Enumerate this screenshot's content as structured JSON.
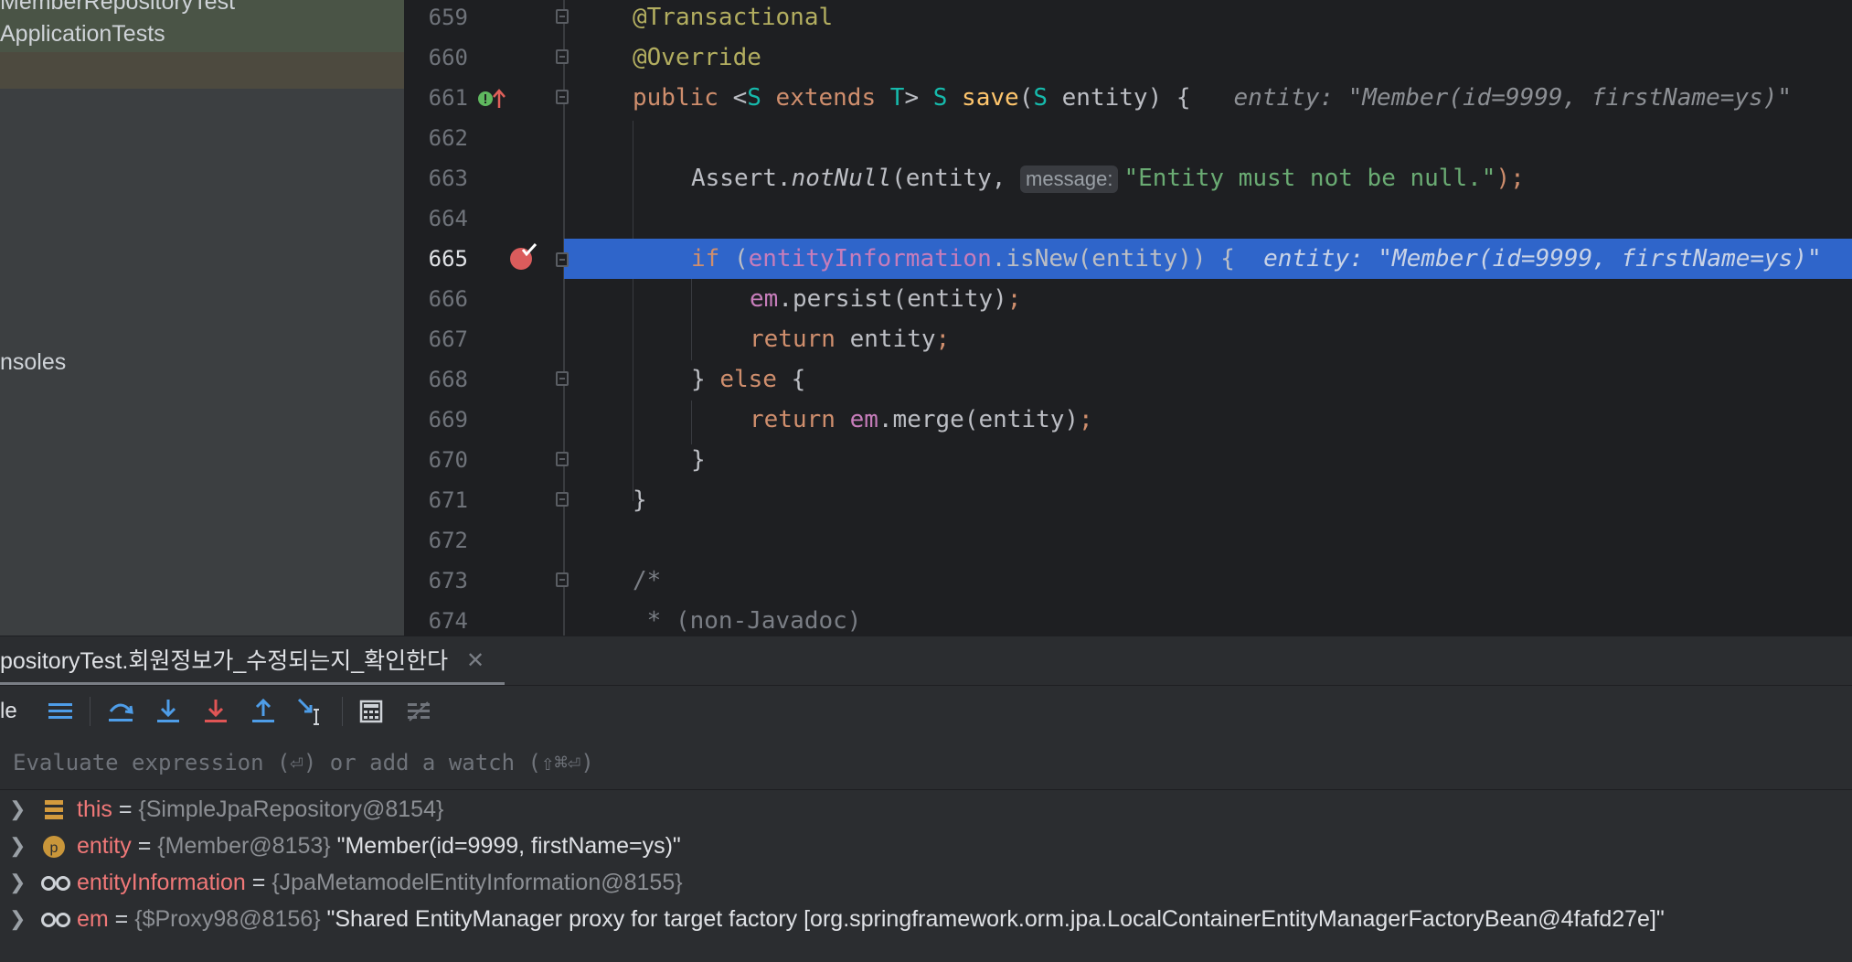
{
  "sidebar": {
    "items": [
      {
        "label": "MemberRepositoryTest"
      },
      {
        "label": "ApplicationTests"
      },
      {
        "label": ""
      },
      {
        "label": "nsoles"
      }
    ]
  },
  "editor": {
    "lines": [
      {
        "num": "659"
      },
      {
        "num": "660"
      },
      {
        "num": "661"
      },
      {
        "num": "662"
      },
      {
        "num": "663"
      },
      {
        "num": "664"
      },
      {
        "num": "665"
      },
      {
        "num": "666"
      },
      {
        "num": "667"
      },
      {
        "num": "668"
      },
      {
        "num": "669"
      },
      {
        "num": "670"
      },
      {
        "num": "671"
      },
      {
        "num": "672"
      },
      {
        "num": "673"
      },
      {
        "num": "674"
      }
    ],
    "code": {
      "l659": "@Transactional",
      "l660": "@Override",
      "l661_public": "public ",
      "l661_lt": "<",
      "l661_S": "S",
      "l661_extends": " extends ",
      "l661_T": "T",
      "l661_gt": "> ",
      "l661_S2": "S",
      "l661_save": " save",
      "l661_paren": "(",
      "l661_S3": "S",
      "l661_rest": " entity) {",
      "l661_hint": "entity: \"Member(id=9999, firstName=ys)\"",
      "l663_assert": "Assert.",
      "l663_notnull": "notNull",
      "l663_args": "(entity, ",
      "l663_inlay": "message:",
      "l663_str": "\"Entity must not be null.\"",
      "l663_end": ");",
      "l665_if": "if ",
      "l665_paren": "(",
      "l665_field": "entityInformation",
      "l665_rest": ".isNew(entity)) {",
      "l665_hint": "entity: \"Member(id=9999, firstName=ys)\"",
      "l666_em": "em",
      "l666_rest": ".persist(entity)",
      "l666_semi": ";",
      "l667_return": "return ",
      "l667_rest": "entity",
      "l667_semi": ";",
      "l668_brace": "} ",
      "l668_else": "else",
      "l668_open": " {",
      "l669_return": "return ",
      "l669_em": "em",
      "l669_rest": ".merge(entity)",
      "l669_semi": ";",
      "l670": "}",
      "l671": "}",
      "l673": "/*",
      "l674": " * (non-Javadoc)"
    }
  },
  "debug": {
    "tab_label": "positoryTest.회원정보가_수정되는지_확인한다",
    "toolbar_left_text": "le",
    "eval_placeholder": "Evaluate expression (⏎) or add a watch (⇧⌘⏎)",
    "variables": [
      {
        "name": "this",
        "eq": " = ",
        "type": "{SimpleJpaRepository@8154}",
        "value": "",
        "icon": "stack-icon"
      },
      {
        "name": "entity",
        "eq": " = ",
        "type": "{Member@8153}",
        "value": " \"Member(id=9999, firstName=ys)\"",
        "icon": "parameter-icon"
      },
      {
        "name": "entityInformation",
        "eq": " = ",
        "type": "{JpaMetamodelEntityInformation@8155}",
        "value": "",
        "icon": "field-icon"
      },
      {
        "name": "em",
        "eq": " = ",
        "type": "{$Proxy98@8156}",
        "value": " \"Shared EntityManager proxy for target factory [org.springframework.orm.jpa.LocalContainerEntityManagerFactoryBean@4fafd27e]\"",
        "icon": "field-icon"
      }
    ]
  },
  "colors": {
    "highlight": "#2f65ca",
    "keyword": "#cf8e6d",
    "string": "#6aab73",
    "field": "#c77dbb",
    "breakpoint": "#db5c5c"
  }
}
